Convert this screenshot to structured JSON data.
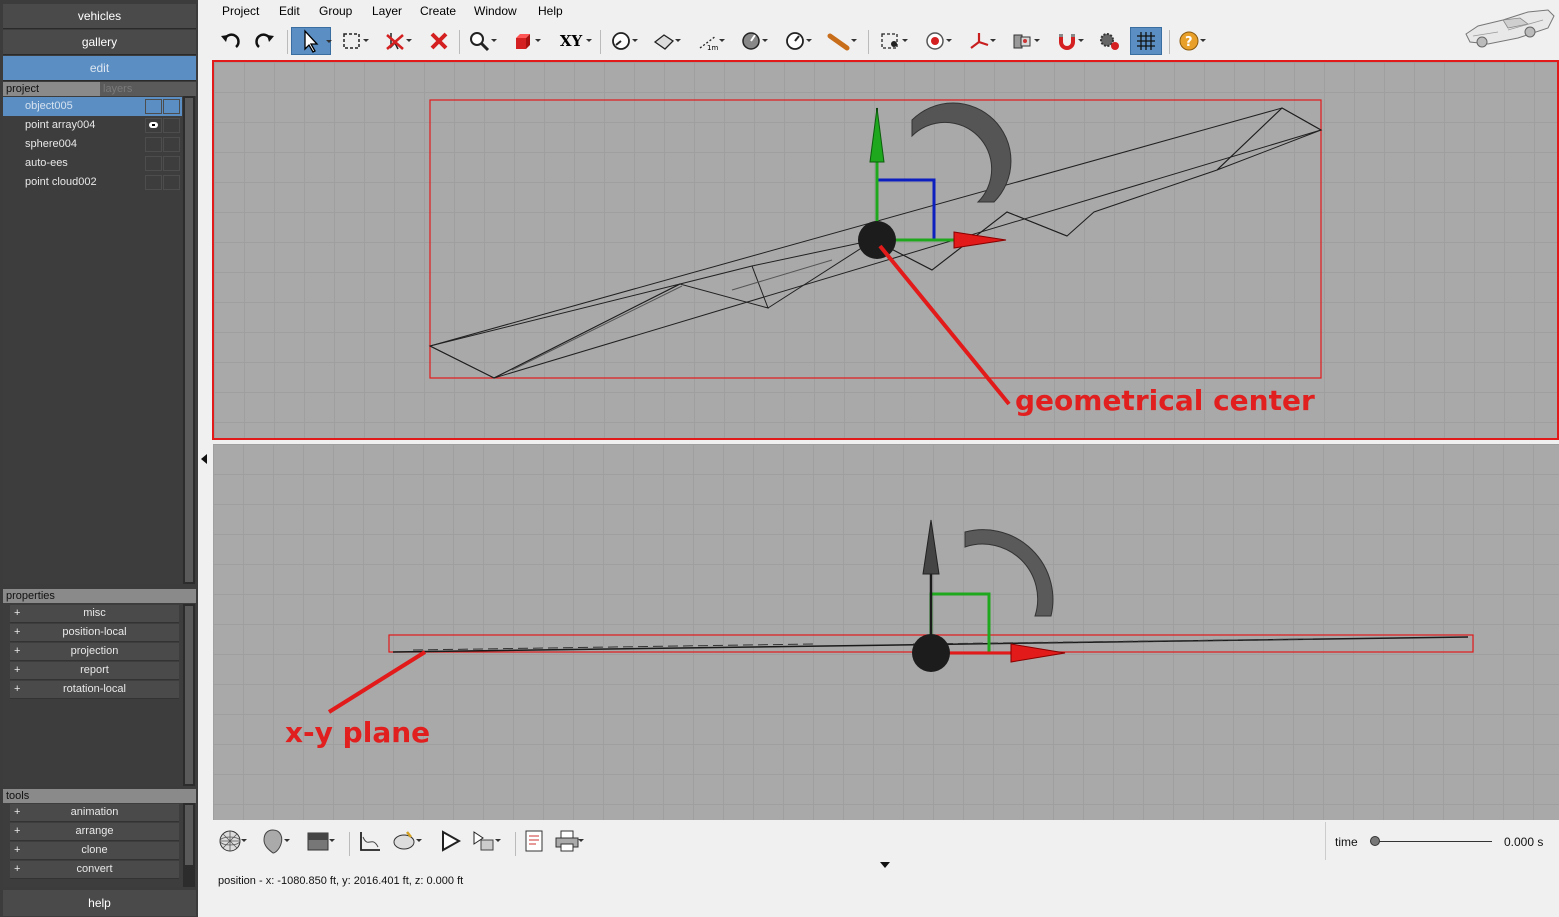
{
  "sidebar": {
    "nav": [
      "vehicles",
      "gallery",
      "edit"
    ],
    "tabs": [
      "project",
      "layers"
    ],
    "tree": [
      "object005",
      "point array004",
      "sphere004",
      "auto-ees",
      "point cloud002"
    ],
    "properties_header": "properties",
    "properties": [
      "misc",
      "position-local",
      "projection",
      "report",
      "rotation-local"
    ],
    "tools_header": "tools",
    "tools": [
      "animation",
      "arrange",
      "clone",
      "convert"
    ],
    "help": "help",
    "plus": "+"
  },
  "menu": [
    "Project",
    "Edit",
    "Group",
    "Layer",
    "Create",
    "Window",
    "Help"
  ],
  "toolbar": {
    "axis_label": "XY",
    "scale_label": "1m"
  },
  "annotations": {
    "top": "geometrical center",
    "bottom": "x-y plane"
  },
  "timeline": {
    "label": "time",
    "value": "0.000 s",
    "position": 0
  },
  "status": "position - x: -1080.850 ft, y: 2016.401 ft, z: 0.000 ft",
  "colors": {
    "accent": "#5b8fc4",
    "annotation": "#e11f1f",
    "viewport": "#a9a9a9",
    "sidebar": "#3c3c3c"
  }
}
